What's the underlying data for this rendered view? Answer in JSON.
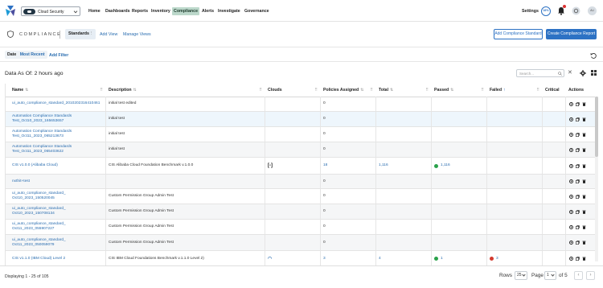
{
  "topnav": {
    "cloud_selector": "Cloud Security",
    "items": [
      "Home",
      "Dashboards",
      "Reports",
      "Inventory",
      "Compliance",
      "Alerts",
      "Investigate",
      "Governance"
    ],
    "active": "Compliance",
    "settings": "Settings",
    "progress_badge": "16%",
    "avatar_initials": "AU"
  },
  "page": {
    "title": "COMPLIANCE",
    "views": [
      "Standards",
      "Add View",
      "Manage Views"
    ],
    "add_standard_button": "Add Compliance Standard",
    "create_report_button": "Create Compliance Report"
  },
  "filters": {
    "date_label": "Date",
    "date_value": "Most Recent",
    "add_filter": "Add Filter"
  },
  "table_meta": {
    "data_as_of": "Data As Of: 2 hours ago",
    "search_placeholder": "Search...",
    "clear_symbol": "✕"
  },
  "table": {
    "columns": [
      "Name",
      "Description",
      "Clouds",
      "Policies Assigned",
      "Total",
      "Passed",
      "Failed",
      "Critical",
      "Actions"
    ],
    "sorted_column": "Failed",
    "rows": [
      {
        "name": "ui_auto_compliance_standard_2010202316410461",
        "description": "initial test edited",
        "clouds": "",
        "policies": "0",
        "total": "",
        "passed": "",
        "failed": ""
      },
      {
        "name": "Automation Compliance Standards\nTest_Oct10_2023_165653657",
        "description": "initial test",
        "clouds": "",
        "policies": "0",
        "total": "",
        "passed": "",
        "failed": ""
      },
      {
        "name": "Automation Compliance Standards\nTest_Oct11_2023_065213673",
        "description": "initial test",
        "clouds": "",
        "policies": "0",
        "total": "",
        "passed": "",
        "failed": ""
      },
      {
        "name": "Automation Compliance Standards\nTest_Oct11_2023_065403622",
        "description": "initial test",
        "clouds": "",
        "policies": "0",
        "total": "",
        "passed": "",
        "failed": ""
      },
      {
        "name": "CIS v1.0.0 (Alibaba Cloud)",
        "description": "CIS Alibaba Cloud Foundation Benchmark v.1.0.0",
        "clouds": "alibaba",
        "policies": "18",
        "total": "1,116",
        "passed": "1,116",
        "failed": ""
      },
      {
        "name": "nxthit+test",
        "description": "",
        "clouds": "",
        "policies": "0",
        "total": "",
        "passed": "",
        "failed": ""
      },
      {
        "name": "ui_auto_compliance_standard_\nOct10_2023_150520045",
        "description": "Custom Permission Group Admin Test",
        "clouds": "",
        "policies": "0",
        "total": "",
        "passed": "",
        "failed": ""
      },
      {
        "name": "ui_auto_compliance_standard_\nOct10_2023_150708134",
        "description": "Custom Permission Group Admin Test",
        "clouds": "",
        "policies": "0",
        "total": "",
        "passed": "",
        "failed": ""
      },
      {
        "name": "ui_auto_compliance_standard_\nOct11_2023_055907227",
        "description": "Custom Permission Group Admin Test",
        "clouds": "",
        "policies": "0",
        "total": "",
        "passed": "",
        "failed": ""
      },
      {
        "name": "ui_auto_compliance_standard_\nOct11_2023_050059079",
        "description": "Custom Permission Group Admin Test",
        "clouds": "",
        "policies": "0",
        "total": "",
        "passed": "",
        "failed": ""
      },
      {
        "name": "CIS v1.1.0 (IBM Cloud) Level 2",
        "description": "CIS IBM Cloud Foundations Benchmark v.1.1.0 Level 2)",
        "clouds": "ibm",
        "policies": "3",
        "total": "4",
        "passed": "1",
        "failed": "3"
      }
    ]
  },
  "footer": {
    "displaying": "Displaying 1 - 25 of 105",
    "rows_label": "Rows",
    "rows_value": "25",
    "page_label": "Page",
    "page_value": "1",
    "of_label": "of 5"
  },
  "colors": {
    "accent": "#2d72c4",
    "link": "#2a6db0",
    "active_nav": "#bcd8cb",
    "passed": "#2aa14a",
    "failed": "#d33b2f"
  }
}
